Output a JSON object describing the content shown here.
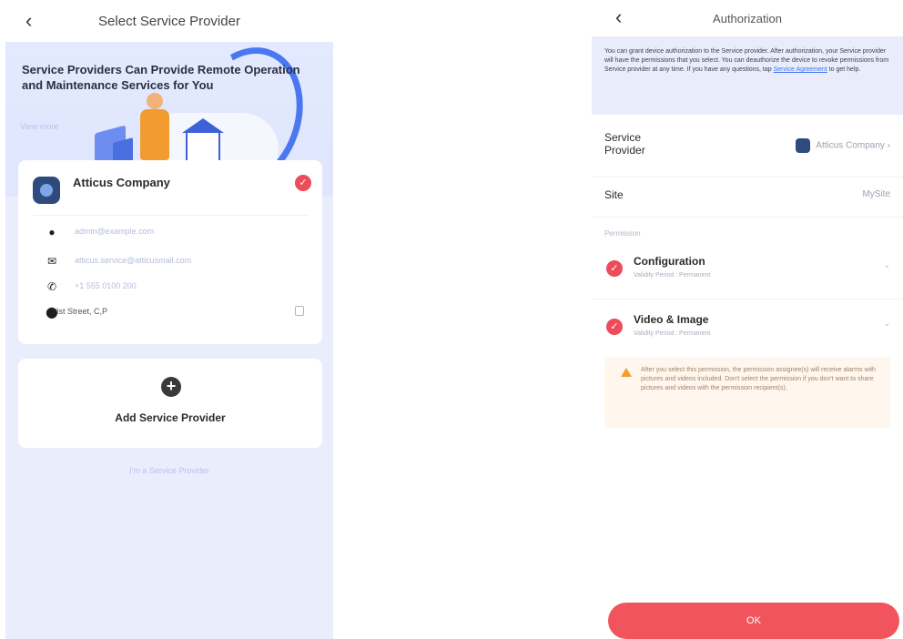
{
  "left": {
    "nav": {
      "back": "‹",
      "title": "Select Service Provider"
    },
    "hero": {
      "title": "Service Providers Can Provide Remote Operation and Maintenance Services for You",
      "link": "View more"
    },
    "provider": {
      "name": "Atticus Company",
      "selected": true,
      "email": "admin@example.com",
      "mail": "atticus.service@atticusmail.com",
      "phone": "+1 555 0100 200",
      "address": "Ist Street, C,P"
    },
    "add": {
      "label": "Add Service Provider"
    },
    "footer_link": "I'm a Service Provider"
  },
  "right": {
    "nav": {
      "back": "‹",
      "title": "Authorization"
    },
    "notice": {
      "text": "You can grant device authorization to the Service provider. After authorization, your Service provider will have the permissions that you select. You can deauthorize the device to revoke permissions from Service provider at any time. If you have any questions, tap ",
      "link": "Service Agreement",
      "tail": " to get help."
    },
    "service_provider": {
      "label": "Service Provider",
      "value": "Atticus Company"
    },
    "site": {
      "label": "Site",
      "value": "MySite"
    },
    "permissions_label": "Permission",
    "permissions": [
      {
        "title": "Configuration",
        "sub": "Validity Period : Permanent"
      },
      {
        "title": "Video & Image",
        "sub": "Validity Period : Permanent"
      }
    ],
    "warning": "After you select this permission, the permission assignee(s) will receive alarms with pictures and videos included. Don't select the permission if you don't want to share pictures and videos with the permission recipient(s).",
    "ok_label": "OK"
  },
  "colors": {
    "accent": "#ee4b5b",
    "ok_button": "#f2545d",
    "brand_blue": "#3b6bf0",
    "left_bg": "#e9edfc"
  }
}
